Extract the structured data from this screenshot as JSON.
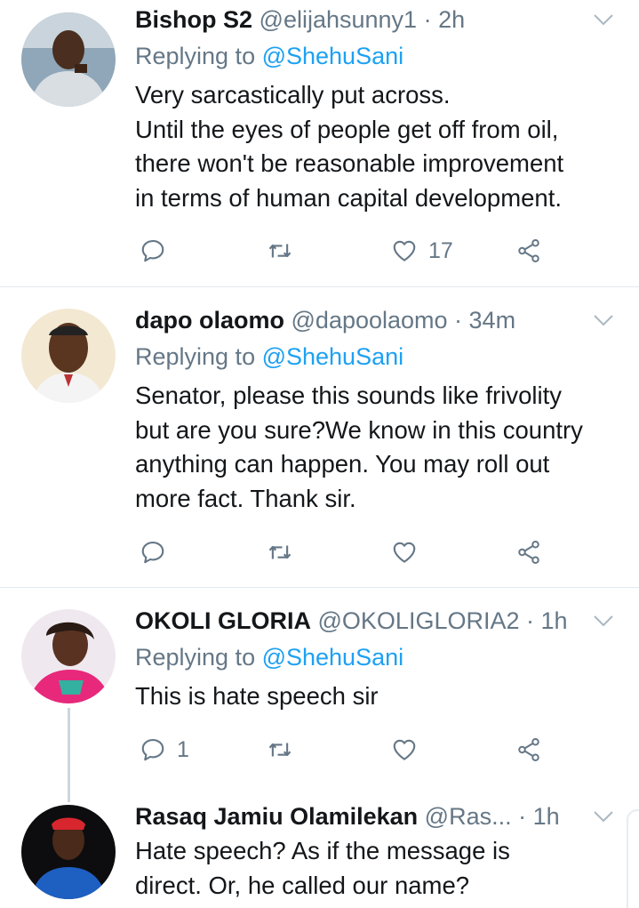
{
  "tweets": [
    {
      "name": "Bishop S2",
      "handle": "@elijahsunny1",
      "time": " · 2h",
      "replying_prefix": "Replying to ",
      "replying_to": "@ShehuSani",
      "body": "Very sarcastically put across.\nUntil the eyes of people get off from oil,\nthere won't be reasonable improvement\nin terms of human capital development.",
      "reply_count": "",
      "retweet_count": "",
      "like_count": "17"
    },
    {
      "name": "dapo olaomo",
      "handle": "@dapoolaomo",
      "time": " · 34m",
      "replying_prefix": "Replying to ",
      "replying_to": "@ShehuSani",
      "body": "Senator, please this sounds like frivolity\nbut are you sure?We know in this country\nanything can happen. You may roll out\nmore fact. Thank sir.",
      "reply_count": "",
      "retweet_count": "",
      "like_count": ""
    },
    {
      "name": "OKOLI GLORIA",
      "handle": "@OKOLIGLORIA2",
      "time": " · 1h",
      "replying_prefix": "Replying to ",
      "replying_to": "@ShehuSani",
      "body": "This is hate speech sir",
      "reply_count": "1",
      "retweet_count": "",
      "like_count": ""
    },
    {
      "name": "Rasaq Jamiu Olamilekan",
      "handle": "@Ras...",
      "time": " · 1h",
      "body": "Hate speech? As if the message is\ndirect. Or, he called our name?"
    }
  ],
  "icons": {
    "reply": "reply-icon",
    "retweet": "retweet-icon",
    "like": "heart-icon",
    "share": "share-icon",
    "menu": "chevron-down-icon"
  },
  "colors": {
    "text": "#14171a",
    "secondary": "#657786",
    "link": "#1da1f2",
    "divider": "#e1e8ed"
  }
}
